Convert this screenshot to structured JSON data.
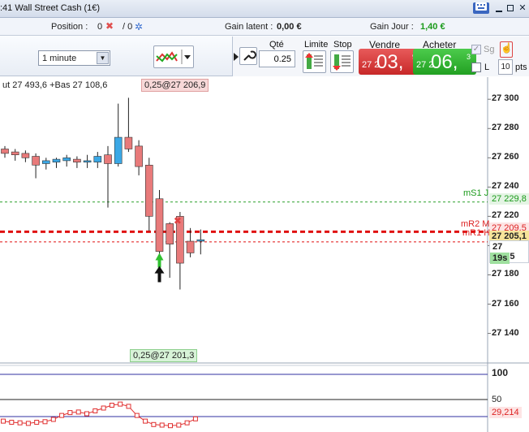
{
  "titlebar": {
    "title": ":41  Wall Street Cash (1€)"
  },
  "infobar": {
    "position_label": "Position :",
    "position_value": "0",
    "position_slash": "/ 0",
    "gain_latent_label": "Gain latent :",
    "gain_latent_value": "0,00 €",
    "gain_jour_label": "Gain Jour :",
    "gain_jour_value": "1,40 €"
  },
  "toolbar": {
    "timeframe": "1 minute"
  },
  "order": {
    "qty_label": "Qté",
    "qty_value": "0.25",
    "limite_label": "Limite",
    "stop_label": "Stop",
    "vendre_label": "Vendre",
    "acheter_label": "Acheter",
    "sell_small": "27 2",
    "sell_big": "03,",
    "sell_sup": "9",
    "buy_small": "27 2",
    "buy_big": "06,",
    "buy_sup": "3",
    "sg_label": "Sg",
    "l_label": "L",
    "pts_value": "10",
    "pts_label": "pts"
  },
  "chart_data": {
    "type": "candlestick",
    "header_text": "ut 27 493,6 +Bas 27 108,6",
    "y_ticks": [
      "27 300",
      "27 280",
      "27 260",
      "27 240",
      "27 220",
      "27 200",
      "27 180",
      "27 160",
      "27 140"
    ],
    "ylim": [
      27132,
      27304
    ],
    "order_tag_top": "0,25@27 206,9",
    "order_tag_bottom": "0,25@27 201,3",
    "level_mS1_label": "mS1 J",
    "level_mS1_value": "27 229,8",
    "level_mR2_label": "mR2 M",
    "level_mR2_value": "27 209,5",
    "level_mR1_label": "mR1 H",
    "level_last_value": "27 205,1",
    "level_bid_value": "27 202,5",
    "countdown": "19s",
    "candles": [
      {
        "o": 27266,
        "h": 27268,
        "l": 27260,
        "c": 27263
      },
      {
        "o": 27264,
        "h": 27266,
        "l": 27258,
        "c": 27262
      },
      {
        "o": 27263,
        "h": 27265,
        "l": 27257,
        "c": 27260
      },
      {
        "o": 27261,
        "h": 27263,
        "l": 27246,
        "c": 27255
      },
      {
        "o": 27256,
        "h": 27260,
        "l": 27252,
        "c": 27258
      },
      {
        "o": 27257,
        "h": 27260,
        "l": 27253,
        "c": 27259
      },
      {
        "o": 27258,
        "h": 27262,
        "l": 27254,
        "c": 27260
      },
      {
        "o": 27259,
        "h": 27261,
        "l": 27253,
        "c": 27257
      },
      {
        "o": 27257,
        "h": 27262,
        "l": 27253,
        "c": 27258
      },
      {
        "o": 27257,
        "h": 27264,
        "l": 27253,
        "c": 27261
      },
      {
        "o": 27262,
        "h": 27268,
        "l": 27226,
        "c": 27256
      },
      {
        "o": 27256,
        "h": 27297,
        "l": 27254,
        "c": 27274
      },
      {
        "o": 27274,
        "h": 27301,
        "l": 27264,
        "c": 27266
      },
      {
        "o": 27268,
        "h": 27272,
        "l": 27248,
        "c": 27254
      },
      {
        "o": 27255,
        "h": 27260,
        "l": 27210,
        "c": 27220
      },
      {
        "o": 27232,
        "h": 27238,
        "l": 27190,
        "c": 27196
      },
      {
        "o": 27215,
        "h": 27216,
        "l": 27178,
        "c": 27201
      },
      {
        "o": 27220,
        "h": 27223,
        "l": 27170,
        "c": 27188
      },
      {
        "o": 27203,
        "h": 27212,
        "l": 27192,
        "c": 27195
      },
      {
        "o": 27203,
        "h": 27211,
        "l": 27194,
        "c": 27204
      }
    ]
  },
  "indicator": {
    "ticks": [
      "100",
      "50"
    ],
    "value_label": "29,214",
    "values": [
      12,
      10,
      9,
      8,
      10,
      11,
      15,
      22,
      27,
      28,
      25,
      30,
      35,
      40,
      42,
      38,
      22,
      12,
      6,
      5,
      4,
      5,
      9,
      16
    ]
  }
}
